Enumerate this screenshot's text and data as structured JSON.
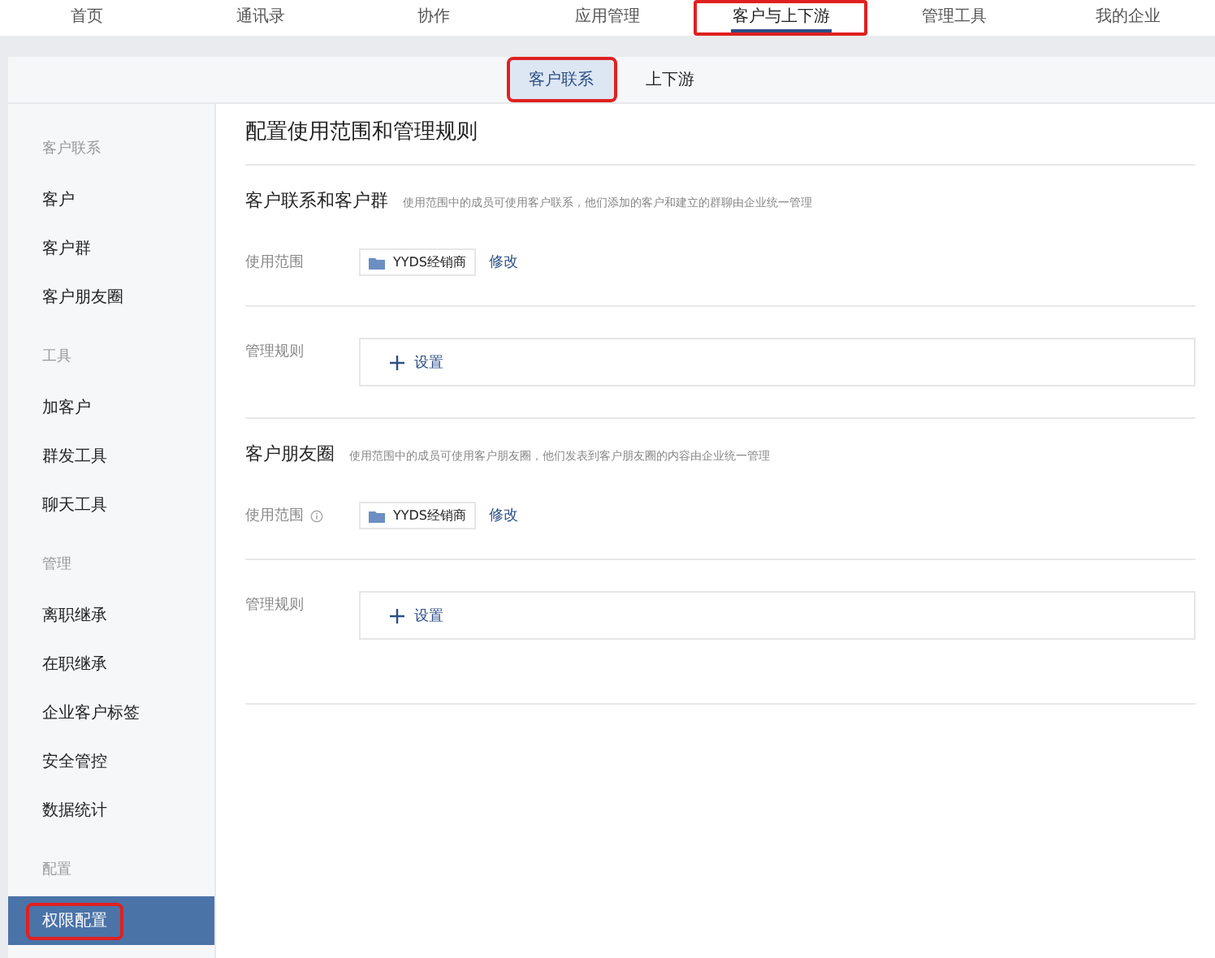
{
  "top_nav": [
    {
      "label": "首页",
      "selected": false,
      "highlighted": false
    },
    {
      "label": "通讯录",
      "selected": false,
      "highlighted": false
    },
    {
      "label": "协作",
      "selected": false,
      "highlighted": false
    },
    {
      "label": "应用管理",
      "selected": false,
      "highlighted": false
    },
    {
      "label": "客户与上下游",
      "selected": true,
      "highlighted": true
    },
    {
      "label": "管理工具",
      "selected": false,
      "highlighted": false
    },
    {
      "label": "我的企业",
      "selected": false,
      "highlighted": false
    }
  ],
  "sub_tabs": [
    {
      "label": "客户联系",
      "selected": true,
      "highlighted": true
    },
    {
      "label": "上下游",
      "selected": false,
      "highlighted": false
    }
  ],
  "sidebar": {
    "groups": [
      {
        "heading": "客户联系",
        "items": [
          {
            "label": "客户",
            "selected": false,
            "highlighted": false
          },
          {
            "label": "客户群",
            "selected": false,
            "highlighted": false
          },
          {
            "label": "客户朋友圈",
            "selected": false,
            "highlighted": false
          }
        ]
      },
      {
        "heading": "工具",
        "items": [
          {
            "label": "加客户",
            "selected": false,
            "highlighted": false
          },
          {
            "label": "群发工具",
            "selected": false,
            "highlighted": false
          },
          {
            "label": "聊天工具",
            "selected": false,
            "highlighted": false
          }
        ]
      },
      {
        "heading": "管理",
        "items": [
          {
            "label": "离职继承",
            "selected": false,
            "highlighted": false
          },
          {
            "label": "在职继承",
            "selected": false,
            "highlighted": false
          },
          {
            "label": "企业客户标签",
            "selected": false,
            "highlighted": false
          },
          {
            "label": "安全管控",
            "selected": false,
            "highlighted": false
          },
          {
            "label": "数据统计",
            "selected": false,
            "highlighted": false
          }
        ]
      },
      {
        "heading": "配置",
        "items": [
          {
            "label": "权限配置",
            "selected": true,
            "highlighted": true
          }
        ]
      }
    ]
  },
  "content": {
    "title": "配置使用范围和管理规则",
    "sections": [
      {
        "title": "客户联系和客户群",
        "description": "使用范围中的成员可使用客户联系，他们添加的客户和建立的群聊由企业统一管理",
        "scope_label": "使用范围",
        "scope_info": false,
        "scope_tag": "YYDS经销商",
        "edit_link": "修改",
        "rule_label": "管理规则",
        "rule_button": "设置"
      },
      {
        "title": "客户朋友圈",
        "description": "使用范围中的成员可使用客户朋友圈，他们发表到客户朋友圈的内容由企业统一管理",
        "scope_label": "使用范围",
        "scope_info": true,
        "scope_tag": "YYDS经销商",
        "edit_link": "修改",
        "rule_label": "管理规则",
        "rule_button": "设置"
      }
    ]
  }
}
